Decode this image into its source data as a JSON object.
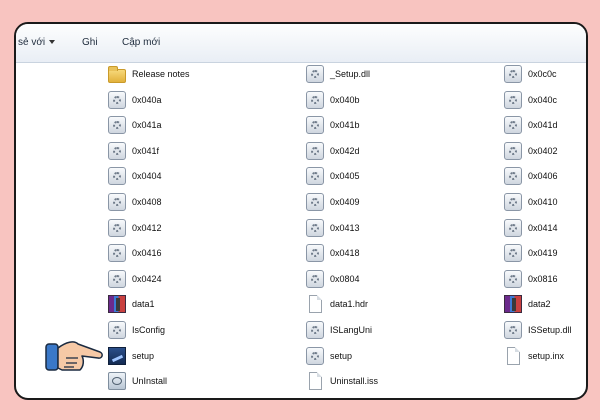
{
  "toolbar": {
    "share_label": "sẻ với",
    "burn_label": "Ghi",
    "new_folder_label": "Cập mới"
  },
  "files": [
    {
      "name": "Release notes",
      "icon": "folder-icon"
    },
    {
      "name": "_Setup.dll",
      "icon": "dll-gear-icon"
    },
    {
      "name": "0x0c0c",
      "icon": "dll-gear-icon"
    },
    {
      "name": "0x040a",
      "icon": "dll-gear-icon"
    },
    {
      "name": "0x040b",
      "icon": "dll-gear-icon"
    },
    {
      "name": "0x040c",
      "icon": "dll-gear-icon"
    },
    {
      "name": "0x041a",
      "icon": "dll-gear-icon"
    },
    {
      "name": "0x041b",
      "icon": "dll-gear-icon"
    },
    {
      "name": "0x041d",
      "icon": "dll-gear-icon"
    },
    {
      "name": "0x041f",
      "icon": "dll-gear-icon"
    },
    {
      "name": "0x042d",
      "icon": "dll-gear-icon"
    },
    {
      "name": "0x0402",
      "icon": "dll-gear-icon"
    },
    {
      "name": "0x0404",
      "icon": "dll-gear-icon"
    },
    {
      "name": "0x0405",
      "icon": "dll-gear-icon"
    },
    {
      "name": "0x0406",
      "icon": "dll-gear-icon"
    },
    {
      "name": "0x0408",
      "icon": "dll-gear-icon"
    },
    {
      "name": "0x0409",
      "icon": "dll-gear-icon"
    },
    {
      "name": "0x0410",
      "icon": "dll-gear-icon"
    },
    {
      "name": "0x0412",
      "icon": "dll-gear-icon"
    },
    {
      "name": "0x0413",
      "icon": "dll-gear-icon"
    },
    {
      "name": "0x0414",
      "icon": "dll-gear-icon"
    },
    {
      "name": "0x0416",
      "icon": "dll-gear-icon"
    },
    {
      "name": "0x0418",
      "icon": "dll-gear-icon"
    },
    {
      "name": "0x0419",
      "icon": "dll-gear-icon"
    },
    {
      "name": "0x0424",
      "icon": "dll-gear-icon"
    },
    {
      "name": "0x0804",
      "icon": "dll-gear-icon"
    },
    {
      "name": "0x0816",
      "icon": "dll-gear-icon"
    },
    {
      "name": "data1",
      "icon": "archive-icon"
    },
    {
      "name": "data1.hdr",
      "icon": "blank-file-icon"
    },
    {
      "name": "data2",
      "icon": "archive-icon"
    },
    {
      "name": "IsConfig",
      "icon": "dll-gear-icon"
    },
    {
      "name": "ISLangUni",
      "icon": "dll-gear-icon"
    },
    {
      "name": "ISSetup.dll",
      "icon": "dll-gear-icon"
    },
    {
      "name": "setup",
      "icon": "setup-installer-icon"
    },
    {
      "name": "setup",
      "icon": "dll-gear-icon"
    },
    {
      "name": "setup.inx",
      "icon": "blank-file-icon"
    },
    {
      "name": "UnInstall",
      "icon": "uninstall-icon"
    },
    {
      "name": "Uninstall.iss",
      "icon": "blank-file-icon"
    }
  ],
  "colors": {
    "page_background": "#f8c4c0",
    "hand_skin": "#f6c9a6",
    "hand_cuff": "#3a78c8"
  }
}
